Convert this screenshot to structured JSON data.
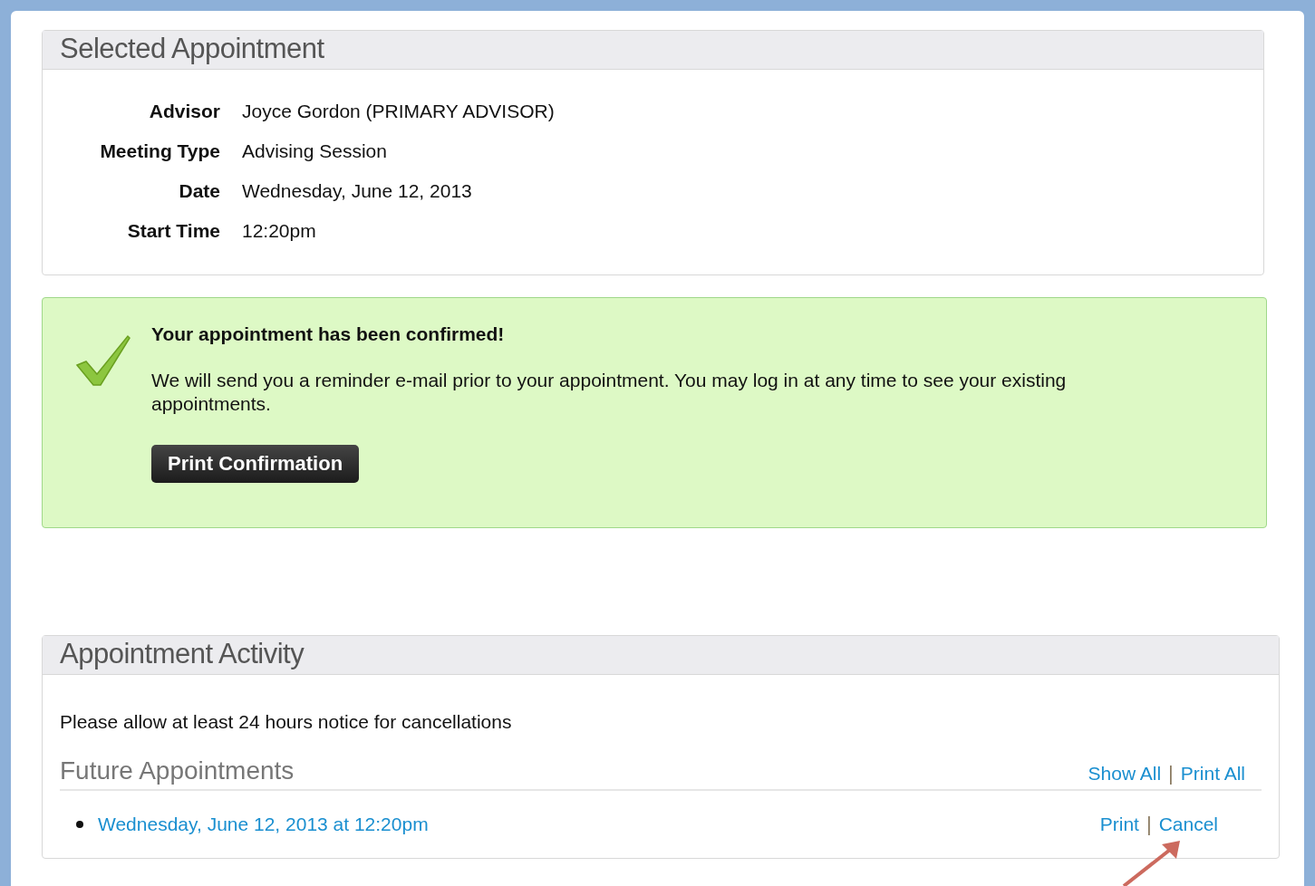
{
  "selected_appointment": {
    "title": "Selected Appointment",
    "fields": [
      {
        "label": "Advisor",
        "value": "Joyce Gordon (PRIMARY ADVISOR)"
      },
      {
        "label": "Meeting Type",
        "value": "Advising Session"
      },
      {
        "label": "Date",
        "value": "Wednesday, June 12, 2013"
      },
      {
        "label": "Start Time",
        "value": "12:20pm"
      }
    ]
  },
  "confirmation": {
    "heading": "Your appointment has been confirmed!",
    "message": "We will send you a reminder e-mail prior to your appointment. You may log in at any time to see your existing appointments.",
    "button": "Print Confirmation"
  },
  "appointment_activity": {
    "title": "Appointment Activity",
    "notice": "Please allow at least 24 hours notice for cancellations",
    "future_appointments": {
      "title": "Future Appointments",
      "links": [
        "Show All",
        "Print All"
      ],
      "separator": "|",
      "items": [
        {
          "label": "Wednesday, June 12, 2013 at 12:20pm",
          "actions": [
            "Print",
            "Cancel"
          ],
          "separator": "|"
        }
      ]
    }
  }
}
